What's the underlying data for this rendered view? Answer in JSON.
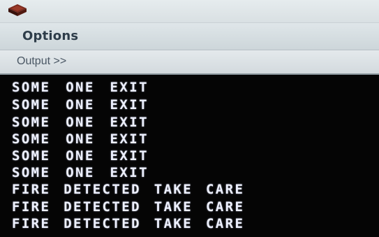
{
  "window": {
    "app_icon": "app-icon"
  },
  "menu": {
    "options_label": "Options"
  },
  "output": {
    "label": "Output >>"
  },
  "console": {
    "lines": [
      "SOME ONE EXIT",
      "SOME ONE EXIT",
      "SOME ONE EXIT",
      "SOME ONE EXIT",
      "SOME ONE EXIT",
      "SOME ONE EXIT",
      "FIRE DETECTED TAKE CARE",
      "FIRE DETECTED TAKE CARE",
      "FIRE DETECTED TAKE CARE"
    ],
    "text_color": "#eef1ff",
    "background_color": "#050505"
  }
}
